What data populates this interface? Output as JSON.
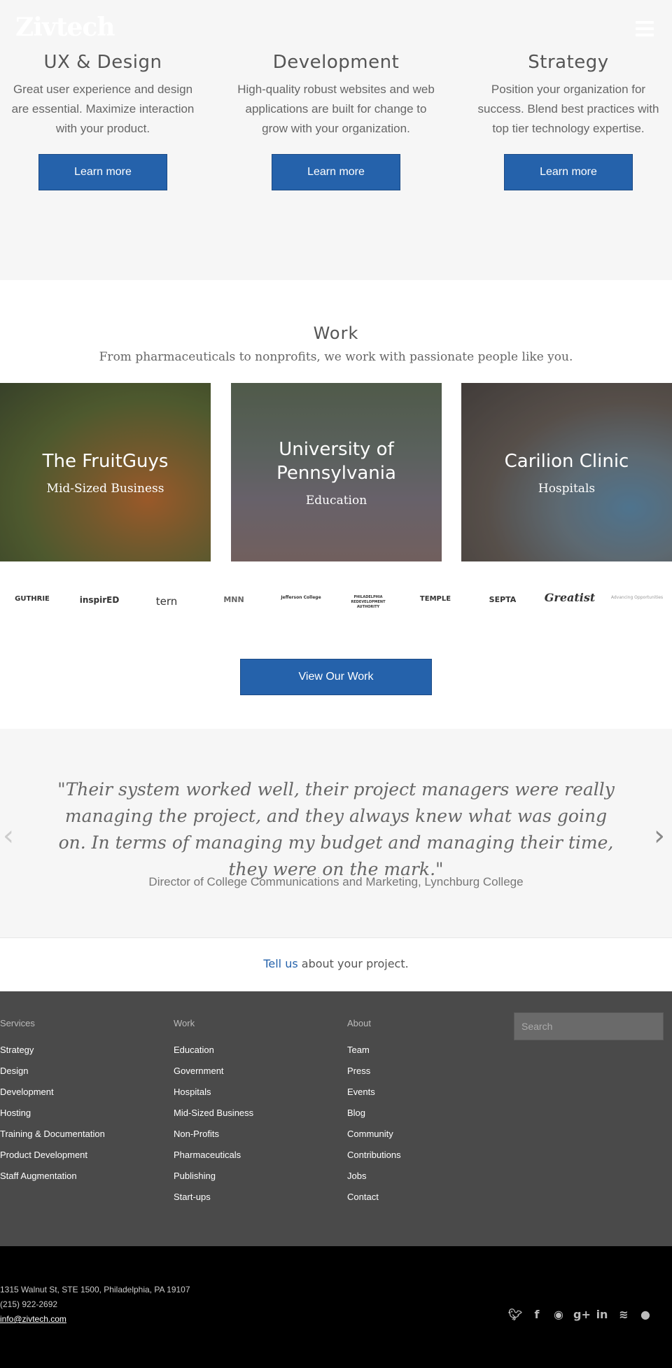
{
  "header": {
    "logo": "Zivtech",
    "menu_icon": "hamburger-menu-icon"
  },
  "services": [
    {
      "title": "UX & Design",
      "text": "Great user experience and design are essential. Maximize interaction with your product.",
      "button": "Learn more"
    },
    {
      "title": "Development",
      "text": "High-quality robust websites and web applications are built for change to grow with your organization.",
      "button": "Learn more"
    },
    {
      "title": "Strategy",
      "text": "Position your organization for success. Blend best practices with top tier technology expertise.",
      "button": "Learn more"
    }
  ],
  "work": {
    "title": "Work",
    "subtitle": "From pharmaceuticals to nonprofits, we work with passionate people like you.",
    "cards": [
      {
        "title": "The FruitGuys",
        "category": "Mid-Sized Business"
      },
      {
        "title": "University of Pennsylvania",
        "category": "Education"
      },
      {
        "title": "Carilion Clinic",
        "category": "Hospitals"
      }
    ],
    "client_logos": [
      "GUTHRIE",
      "inspirED",
      "tern",
      "MNN",
      "Jefferson College",
      "PHILADELPHIA REDEVELOPMENT AUTHORITY",
      "TEMPLE",
      "SEPTA",
      "Greatist",
      "Advancing Opportunities"
    ],
    "view_button": "View Our Work"
  },
  "testimonial": {
    "quote": "\"Their system worked well, their project managers were really managing the project, and they always knew what was going on. In terms of managing my budget and managing their time, they were on the mark.\"",
    "attribution": "Director of College Communications and Marketing, Lynchburg College",
    "prev": "‹",
    "next": "›"
  },
  "cta": {
    "link": "Tell us",
    "rest": " about your project."
  },
  "footer": {
    "services": {
      "head": "Services",
      "items": [
        "Strategy",
        "Design",
        "Development",
        "Hosting",
        "Training & Documentation",
        "Product Development",
        "Staff Augmentation"
      ]
    },
    "work": {
      "head": "Work",
      "items": [
        "Education",
        "Government",
        "Hospitals",
        "Mid-Sized Business",
        "Non-Profits",
        "Pharmaceuticals",
        "Publishing",
        "Start-ups"
      ]
    },
    "about": {
      "head": "About",
      "items": [
        "Team",
        "Press",
        "Events",
        "Blog",
        "Community",
        "Contributions",
        "Jobs",
        "Contact"
      ]
    },
    "search_placeholder": "Search"
  },
  "contact": {
    "address": "1315 Walnut St, STE 1500, Philadelphia, PA 19107",
    "phone": "(215) 922-2692",
    "email": "info@zivtech.com"
  },
  "social": [
    "twitter-icon",
    "facebook-icon",
    "github-icon",
    "google-plus-icon",
    "linkedin-icon",
    "rss-icon",
    "drupal-icon"
  ]
}
